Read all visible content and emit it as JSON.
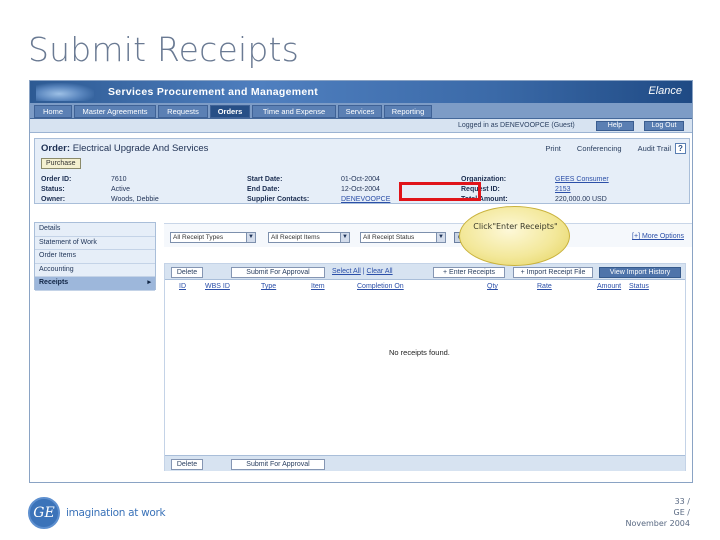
{
  "slide": {
    "title": "Submit Receipts",
    "tagline": "imagination at work",
    "logo_text": "GE",
    "page_number": "33 /",
    "company": "GE /",
    "date": "November 2004"
  },
  "app": {
    "title": "Services Procurement and Management",
    "brand": "Elance"
  },
  "nav": {
    "tabs": [
      {
        "label": "Home"
      },
      {
        "label": "Master Agreements"
      },
      {
        "label": "Requests"
      },
      {
        "label": "Orders",
        "active": true
      },
      {
        "label": "Time and Expense"
      },
      {
        "label": "Services"
      },
      {
        "label": "Reporting"
      }
    ]
  },
  "util": {
    "logged_in": "Logged in as DENEVOOPCE (Guest)",
    "help_label": "Help",
    "logout_label": "Log Out"
  },
  "order": {
    "heading_prefix": "Order:",
    "heading_name": "Electrical Upgrade And Services",
    "print_label": "Print",
    "conference_label": "Conferencing",
    "audit_label": "Audit Trail",
    "help_icon": "?",
    "button_label": "Purchase",
    "fields": {
      "order_id_label": "Order ID:",
      "order_id_value": "7610",
      "status_label": "Status:",
      "status_value": "Active",
      "owner_label": "Owner:",
      "owner_value": "Woods, Debbie",
      "start_label": "Start Date:",
      "start_value": "01-Oct-2004",
      "end_label": "End Date:",
      "end_value": "12-Oct-2004",
      "contacts_label": "Supplier Contacts:",
      "contacts_value": "DENEVOOPCE",
      "org_label": "Organization:",
      "org_value": "GEES Consumer",
      "request_label": "Request ID:",
      "request_value": "2153",
      "total_label": "Total Amount:",
      "total_value": "220,000.00 USD"
    }
  },
  "sidebar": {
    "items": [
      {
        "label": "Details"
      },
      {
        "label": "Statement of Work"
      },
      {
        "label": "Order Items"
      },
      {
        "label": "Accounting"
      },
      {
        "label": "Receipts",
        "active": true
      }
    ],
    "active_marker": "▸"
  },
  "filters": {
    "types_value": "All Receipt Types",
    "items_value": "All Receipt Items",
    "status_value": "All Receipt Status",
    "go_label": "GO",
    "more_options": "[+] More Options",
    "arrow_glyph": "▼"
  },
  "actions": {
    "delete_label": "Delete",
    "submit_label": "Submit For Approval",
    "select_all": "Select All",
    "separator": "|",
    "clear_all": "Clear All",
    "enter_receipts": "+ Enter Receipts",
    "import_receipts": "+ Import Receipt File",
    "view_history": "View Import History"
  },
  "table": {
    "columns": [
      "ID",
      "WBS ID",
      "Type",
      "Item",
      "Completion On",
      "Qty",
      "Rate",
      "Amount",
      "Status"
    ],
    "empty_message": "No receipts found."
  },
  "callout": {
    "text": "Click\"Enter Receipts\""
  },
  "colors": {
    "highlight": "#e0141a",
    "header_blue": "#2d5a93",
    "title_gray": "#6a7a93",
    "ge_blue": "#3b73b9"
  }
}
